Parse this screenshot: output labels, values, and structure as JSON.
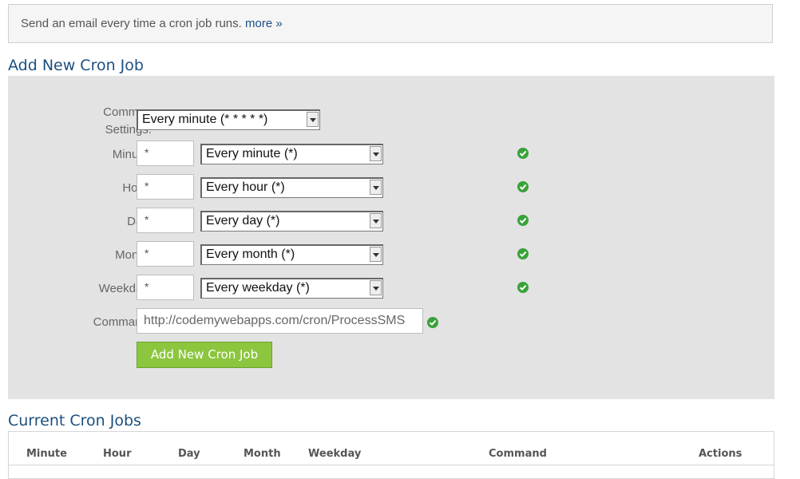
{
  "notice": {
    "text": "Send an email every time a cron job runs.",
    "link": "more »"
  },
  "add_section": {
    "title": "Add New Cron Job",
    "common_settings": {
      "label_line1": "Common",
      "label_line2": "Settings:",
      "selected": "Every minute (* * * * *)"
    },
    "fields": [
      {
        "label": "Minute:",
        "value": "*",
        "selected": "Every minute (*)"
      },
      {
        "label": "Hour:",
        "value": "*",
        "selected": "Every hour (*)"
      },
      {
        "label": "Day:",
        "value": "*",
        "selected": "Every day (*)"
      },
      {
        "label": "Month:",
        "value": "*",
        "selected": "Every month (*)"
      },
      {
        "label": "Weekday:",
        "value": "*",
        "selected": "Every weekday (*)"
      }
    ],
    "command": {
      "label": "Command:",
      "value": "http://codemywebapps.com/cron/ProcessSMS"
    },
    "submit_label": "Add New Cron Job"
  },
  "current_section": {
    "title": "Current Cron Jobs",
    "columns": [
      "Minute",
      "Hour",
      "Day",
      "Month",
      "Weekday",
      "Command",
      "Actions"
    ]
  },
  "colors": {
    "accent_green": "#8cc63f",
    "check_green": "#3aa23a",
    "title_blue": "#1c4f80",
    "link_blue": "#1a4f8a",
    "panel_gray": "#e3e3e3"
  },
  "icons": {
    "valid": "check-circle-icon",
    "dropdown": "dropdown-arrow-icon"
  }
}
